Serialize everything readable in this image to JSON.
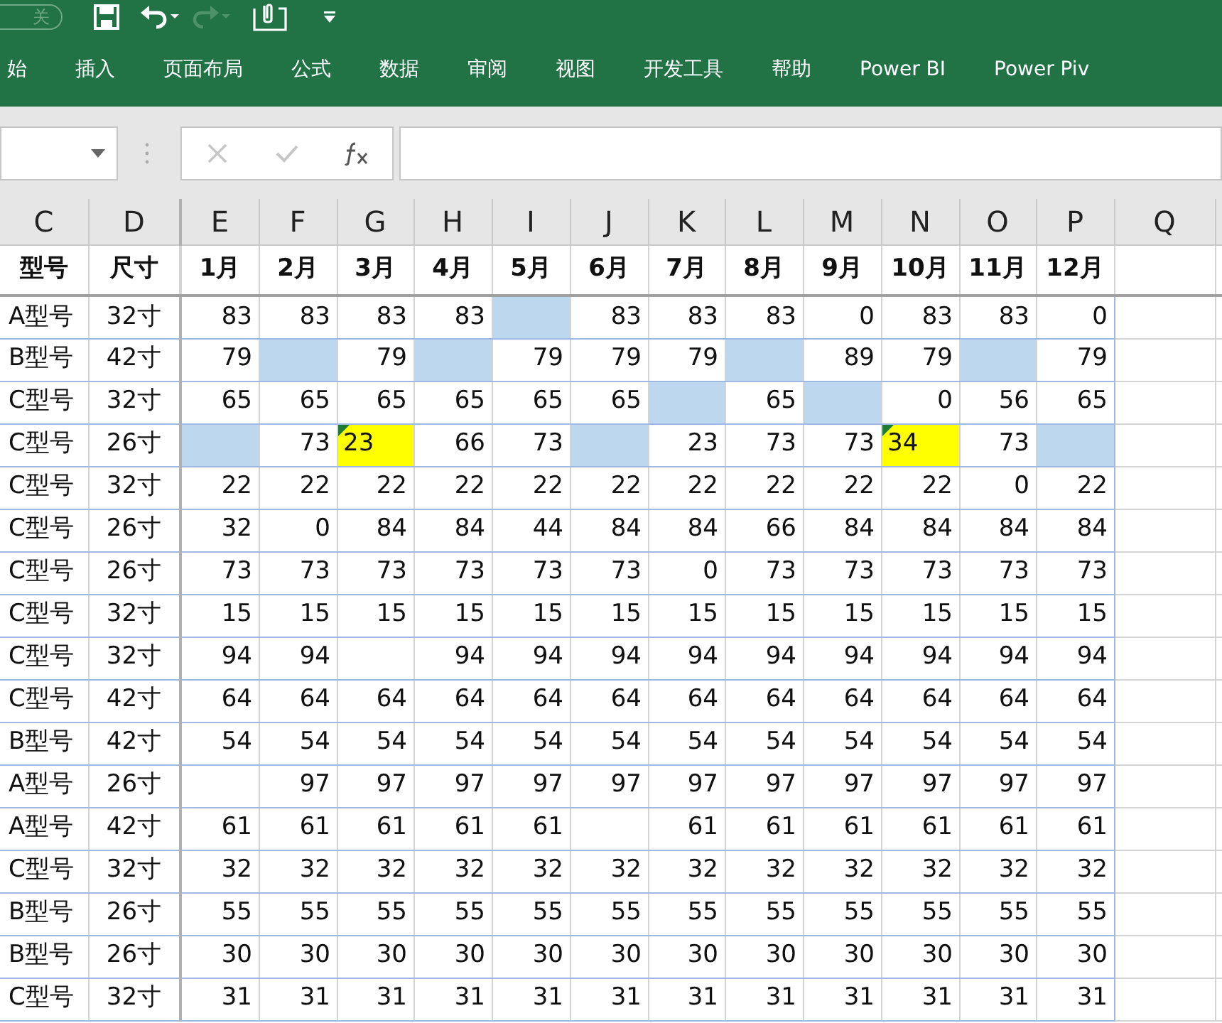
{
  "quick_access": {
    "autosave": {
      "label": "关",
      "on": false
    },
    "redo_disabled": true
  },
  "ribbon_tabs": [
    "始",
    "插入",
    "页面布局",
    "公式",
    "数据",
    "审阅",
    "视图",
    "开发工具",
    "帮助",
    "Power BI",
    "Power Piv"
  ],
  "formula_bar": {
    "buttons": [
      {
        "kind": "cancel",
        "disabled": true
      },
      {
        "kind": "enter",
        "disabled": true
      },
      {
        "kind": "function",
        "disabled": false
      }
    ]
  },
  "column_headers": [
    "C",
    "D",
    "E",
    "F",
    "G",
    "H",
    "I",
    "J",
    "K",
    "L",
    "M",
    "N",
    "O",
    "P",
    "Q"
  ],
  "table": {
    "columns": [
      "型号",
      "尺寸",
      "1月",
      "2月",
      "3月",
      "4月",
      "5月",
      "6月",
      "7月",
      "8月",
      "9月",
      "10月",
      "11月",
      "12月"
    ],
    "rows": [
      {
        "cells": [
          {
            "kind": "model",
            "text": "A型号"
          },
          {
            "kind": "size",
            "text": "32寸"
          },
          {
            "text": "83"
          },
          {
            "text": "83"
          },
          {
            "text": "83"
          },
          {
            "text": "83"
          },
          {
            "kind": "gap"
          },
          {
            "text": "83"
          },
          {
            "text": "83"
          },
          {
            "text": "83"
          },
          {
            "text": "0"
          },
          {
            "text": "83"
          },
          {
            "text": "83"
          },
          {
            "text": "0"
          }
        ]
      },
      {
        "cells": [
          {
            "kind": "model",
            "text": "B型号"
          },
          {
            "kind": "size",
            "text": "42寸"
          },
          {
            "text": "79"
          },
          {
            "kind": "gap"
          },
          {
            "text": "79"
          },
          {
            "kind": "gap"
          },
          {
            "text": "79"
          },
          {
            "text": "79"
          },
          {
            "text": "79"
          },
          {
            "kind": "gap"
          },
          {
            "text": "89"
          },
          {
            "text": "79"
          },
          {
            "kind": "gap"
          },
          {
            "text": "79"
          }
        ]
      },
      {
        "cells": [
          {
            "kind": "model",
            "text": "C型号"
          },
          {
            "kind": "size",
            "text": "32寸"
          },
          {
            "text": "65"
          },
          {
            "text": "65"
          },
          {
            "text": "65"
          },
          {
            "text": "65"
          },
          {
            "text": "65"
          },
          {
            "text": "65"
          },
          {
            "kind": "gap"
          },
          {
            "text": "65"
          },
          {
            "kind": "gap"
          },
          {
            "text": "0"
          },
          {
            "text": "56"
          },
          {
            "text": "65"
          }
        ]
      },
      {
        "cells": [
          {
            "kind": "model",
            "text": "C型号"
          },
          {
            "kind": "size",
            "text": "26寸"
          },
          {
            "kind": "gap"
          },
          {
            "text": "73"
          },
          {
            "kind": "error",
            "text": "23"
          },
          {
            "text": "66"
          },
          {
            "text": "73"
          },
          {
            "kind": "gap"
          },
          {
            "text": "23"
          },
          {
            "text": "73"
          },
          {
            "text": "73"
          },
          {
            "kind": "error",
            "text": "34"
          },
          {
            "text": "73"
          },
          {
            "kind": "gap"
          }
        ]
      },
      {
        "cells": [
          {
            "kind": "model",
            "text": "C型号"
          },
          {
            "kind": "size",
            "text": "32寸"
          },
          {
            "text": "22"
          },
          {
            "text": "22"
          },
          {
            "text": "22"
          },
          {
            "text": "22"
          },
          {
            "text": "22"
          },
          {
            "text": "22"
          },
          {
            "text": "22"
          },
          {
            "text": "22"
          },
          {
            "text": "22"
          },
          {
            "text": "22"
          },
          {
            "text": "0"
          },
          {
            "text": "22"
          }
        ]
      },
      {
        "cells": [
          {
            "kind": "model",
            "text": "C型号"
          },
          {
            "kind": "size",
            "text": "26寸"
          },
          {
            "text": "32"
          },
          {
            "text": "0"
          },
          {
            "text": "84"
          },
          {
            "text": "84"
          },
          {
            "text": "44"
          },
          {
            "text": "84"
          },
          {
            "text": "84"
          },
          {
            "text": "66"
          },
          {
            "text": "84"
          },
          {
            "text": "84"
          },
          {
            "text": "84"
          },
          {
            "text": "84"
          }
        ]
      },
      {
        "cells": [
          {
            "kind": "model",
            "text": "C型号"
          },
          {
            "kind": "size",
            "text": "26寸"
          },
          {
            "text": "73"
          },
          {
            "text": "73"
          },
          {
            "text": "73"
          },
          {
            "text": "73"
          },
          {
            "text": "73"
          },
          {
            "text": "73"
          },
          {
            "text": "0"
          },
          {
            "text": "73"
          },
          {
            "text": "73"
          },
          {
            "text": "73"
          },
          {
            "text": "73"
          },
          {
            "text": "73"
          }
        ]
      },
      {
        "cells": [
          {
            "kind": "model",
            "text": "C型号"
          },
          {
            "kind": "size",
            "text": "32寸"
          },
          {
            "text": "15"
          },
          {
            "text": "15"
          },
          {
            "text": "15"
          },
          {
            "text": "15"
          },
          {
            "text": "15"
          },
          {
            "text": "15"
          },
          {
            "text": "15"
          },
          {
            "text": "15"
          },
          {
            "text": "15"
          },
          {
            "text": "15"
          },
          {
            "text": "15"
          },
          {
            "text": "15"
          }
        ]
      },
      {
        "cells": [
          {
            "kind": "model",
            "text": "C型号"
          },
          {
            "kind": "size",
            "text": "32寸"
          },
          {
            "text": "94"
          },
          {
            "text": "94"
          },
          {
            "kind": "empty"
          },
          {
            "text": "94"
          },
          {
            "text": "94"
          },
          {
            "text": "94"
          },
          {
            "text": "94"
          },
          {
            "text": "94"
          },
          {
            "text": "94"
          },
          {
            "text": "94"
          },
          {
            "text": "94"
          },
          {
            "text": "94"
          }
        ]
      },
      {
        "cells": [
          {
            "kind": "model",
            "text": "C型号"
          },
          {
            "kind": "size",
            "text": "42寸"
          },
          {
            "text": "64"
          },
          {
            "text": "64"
          },
          {
            "text": "64"
          },
          {
            "text": "64"
          },
          {
            "text": "64"
          },
          {
            "text": "64"
          },
          {
            "text": "64"
          },
          {
            "text": "64"
          },
          {
            "text": "64"
          },
          {
            "text": "64"
          },
          {
            "text": "64"
          },
          {
            "text": "64"
          }
        ]
      },
      {
        "cells": [
          {
            "kind": "model",
            "text": "B型号"
          },
          {
            "kind": "size",
            "text": "42寸"
          },
          {
            "text": "54"
          },
          {
            "text": "54"
          },
          {
            "text": "54"
          },
          {
            "text": "54"
          },
          {
            "text": "54"
          },
          {
            "text": "54"
          },
          {
            "text": "54"
          },
          {
            "text": "54"
          },
          {
            "text": "54"
          },
          {
            "text": "54"
          },
          {
            "text": "54"
          },
          {
            "text": "54"
          }
        ]
      },
      {
        "cells": [
          {
            "kind": "model",
            "text": "A型号"
          },
          {
            "kind": "size",
            "text": "26寸"
          },
          {
            "kind": "empty"
          },
          {
            "text": "97"
          },
          {
            "text": "97"
          },
          {
            "text": "97"
          },
          {
            "text": "97"
          },
          {
            "text": "97"
          },
          {
            "text": "97"
          },
          {
            "text": "97"
          },
          {
            "text": "97"
          },
          {
            "text": "97"
          },
          {
            "text": "97"
          },
          {
            "text": "97"
          }
        ]
      },
      {
        "cells": [
          {
            "kind": "model",
            "text": "A型号"
          },
          {
            "kind": "size",
            "text": "42寸"
          },
          {
            "text": "61"
          },
          {
            "text": "61"
          },
          {
            "text": "61"
          },
          {
            "text": "61"
          },
          {
            "text": "61"
          },
          {
            "kind": "empty"
          },
          {
            "text": "61"
          },
          {
            "text": "61"
          },
          {
            "text": "61"
          },
          {
            "text": "61"
          },
          {
            "text": "61"
          },
          {
            "text": "61"
          }
        ]
      },
      {
        "cells": [
          {
            "kind": "model",
            "text": "C型号"
          },
          {
            "kind": "size",
            "text": "32寸"
          },
          {
            "text": "32"
          },
          {
            "text": "32"
          },
          {
            "text": "32"
          },
          {
            "text": "32"
          },
          {
            "text": "32"
          },
          {
            "text": "32"
          },
          {
            "text": "32"
          },
          {
            "text": "32"
          },
          {
            "text": "32"
          },
          {
            "text": "32"
          },
          {
            "text": "32"
          },
          {
            "text": "32"
          }
        ]
      },
      {
        "cells": [
          {
            "kind": "model",
            "text": "B型号"
          },
          {
            "kind": "size",
            "text": "26寸"
          },
          {
            "text": "55"
          },
          {
            "text": "55"
          },
          {
            "text": "55"
          },
          {
            "text": "55"
          },
          {
            "text": "55"
          },
          {
            "text": "55"
          },
          {
            "text": "55"
          },
          {
            "text": "55"
          },
          {
            "text": "55"
          },
          {
            "text": "55"
          },
          {
            "text": "55"
          },
          {
            "text": "55"
          }
        ]
      },
      {
        "cells": [
          {
            "kind": "model",
            "text": "B型号"
          },
          {
            "kind": "size",
            "text": "26寸"
          },
          {
            "text": "30"
          },
          {
            "text": "30"
          },
          {
            "text": "30"
          },
          {
            "text": "30"
          },
          {
            "text": "30"
          },
          {
            "text": "30"
          },
          {
            "text": "30"
          },
          {
            "text": "30"
          },
          {
            "text": "30"
          },
          {
            "text": "30"
          },
          {
            "text": "30"
          },
          {
            "text": "30"
          }
        ]
      },
      {
        "cells": [
          {
            "kind": "model",
            "text": "C型号"
          },
          {
            "kind": "size",
            "text": "32寸"
          },
          {
            "text": "31"
          },
          {
            "text": "31"
          },
          {
            "text": "31"
          },
          {
            "text": "31"
          },
          {
            "text": "31"
          },
          {
            "text": "31"
          },
          {
            "text": "31"
          },
          {
            "text": "31"
          },
          {
            "text": "31"
          },
          {
            "text": "31"
          },
          {
            "text": "31"
          },
          {
            "text": "31"
          }
        ]
      }
    ]
  }
}
